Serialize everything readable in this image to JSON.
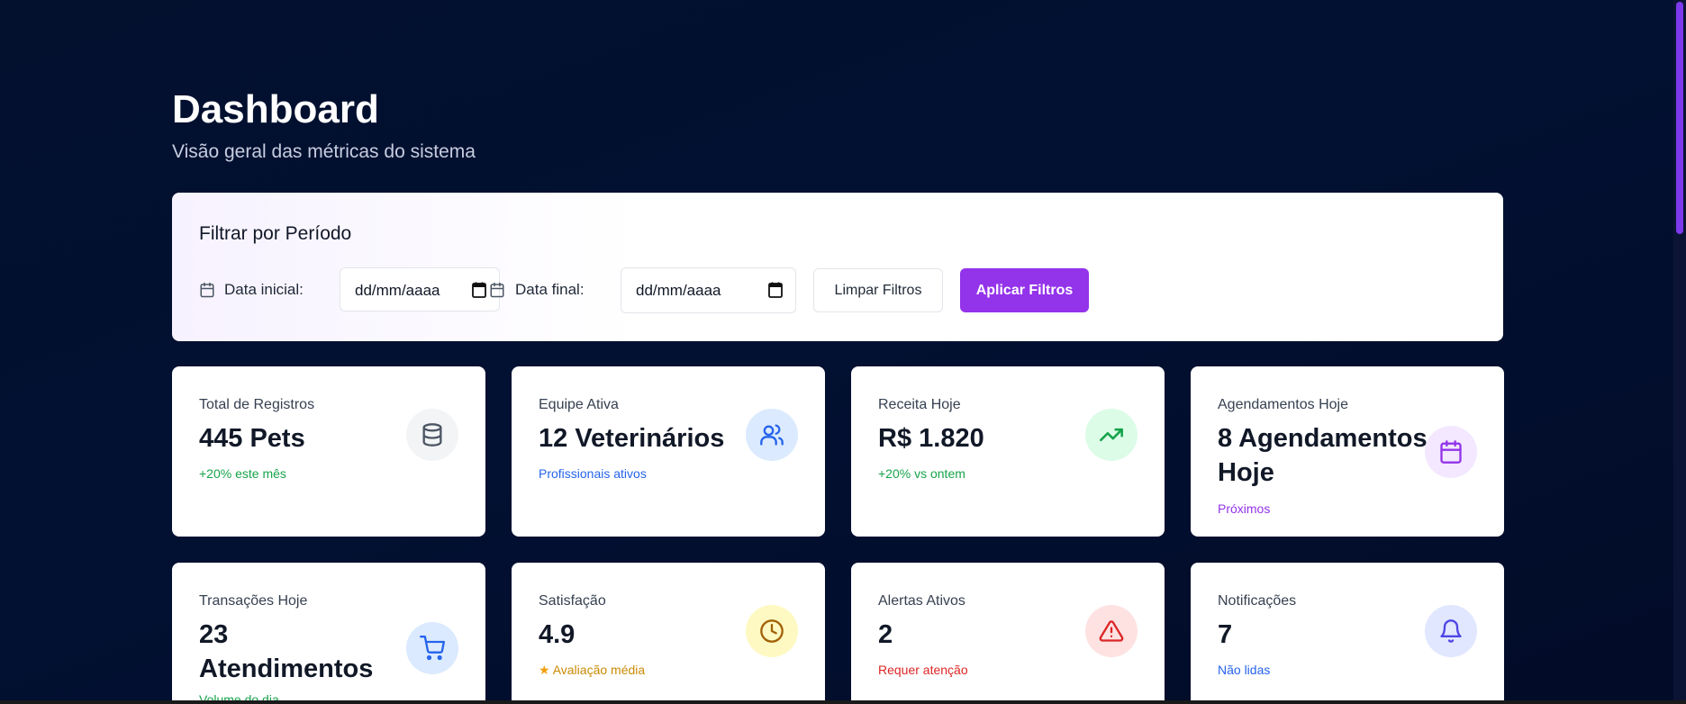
{
  "header": {
    "title": "Dashboard",
    "subtitle": "Visão geral das métricas do sistema"
  },
  "filters": {
    "title": "Filtrar por Período",
    "start_label": "Data inicial:",
    "start_placeholder": "dd/mm/aaaa",
    "end_label": "Data final:",
    "end_placeholder": "dd/mm/aaaa",
    "clear_label": "Limpar Filtros",
    "apply_label": "Aplicar Filtros"
  },
  "colors": {
    "background": "#020c2c",
    "accent": "#9333ea",
    "positive": "#16a34a",
    "info": "#2563eb",
    "danger": "#dc2626",
    "warning": "#ca8a04"
  },
  "cards": [
    {
      "label": "Total de Registros",
      "value": "445 Pets",
      "note": "+20% este mês",
      "note_color": "#16a34a",
      "icon": "database-icon",
      "icon_bg": "#f3f4f6",
      "icon_color": "#4b5563"
    },
    {
      "label": "Equipe Ativa",
      "value": "12 Veterinários",
      "note": "Profissionais ativos",
      "note_color": "#2563eb",
      "icon": "users-icon",
      "icon_bg": "#dbeafe",
      "icon_color": "#2563eb"
    },
    {
      "label": "Receita Hoje",
      "value": "R$ 1.820",
      "note": "+20% vs ontem",
      "note_color": "#16a34a",
      "icon": "trending-up-icon",
      "icon_bg": "#dcfce7",
      "icon_color": "#16a34a"
    },
    {
      "label": "Agendamentos Hoje",
      "value": "8 Agendamentos Hoje",
      "note": "Próximos",
      "note_color": "#9333ea",
      "icon": "calendar-icon",
      "icon_bg": "#f3e8ff",
      "icon_color": "#9333ea"
    },
    {
      "label": "Transações Hoje",
      "value": "23 Atendimentos",
      "note": "Volume do dia",
      "note_color": "#16a34a",
      "icon": "shopping-cart-icon",
      "icon_bg": "#dbeafe",
      "icon_color": "#2563eb"
    },
    {
      "label": "Satisfação",
      "value": "4.9",
      "note": "Avaliação média",
      "note_color": "#ca8a04",
      "icon": "clock-icon",
      "icon_bg": "#fef9c3",
      "icon_color": "#a16207"
    },
    {
      "label": "Alertas Ativos",
      "value": "2",
      "note": "Requer atenção",
      "note_color": "#dc2626",
      "icon": "alert-triangle-icon",
      "icon_bg": "#fee2e2",
      "icon_color": "#dc2626"
    },
    {
      "label": "Notificações",
      "value": "7",
      "note": "Não lidas",
      "note_color": "#2563eb",
      "icon": "bell-icon",
      "icon_bg": "#e0e7ff",
      "icon_color": "#4f46e5"
    }
  ]
}
